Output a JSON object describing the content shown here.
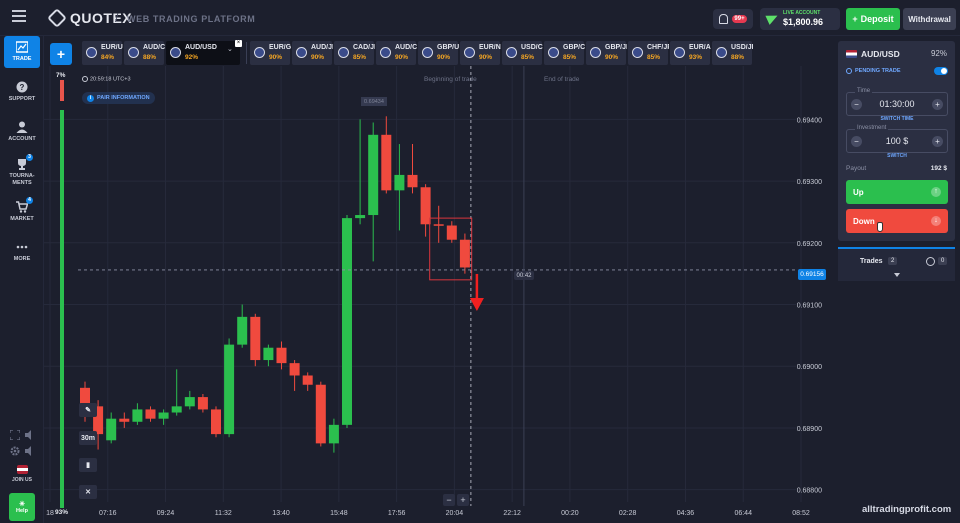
{
  "header": {
    "logo_text": "QUOTEX",
    "subtitle": "WEB TRADING PLATFORM",
    "notifications_badge": "99+",
    "account_type": "LIVE ACCOUNT",
    "balance": "$1,800.96",
    "deposit_label": "Deposit",
    "withdrawal_label": "Withdrawal"
  },
  "sidebar": {
    "items": [
      {
        "label": "TRADE",
        "icon": "chart-icon",
        "active": true
      },
      {
        "label": "SUPPORT",
        "icon": "question-icon"
      },
      {
        "label": "ACCOUNT",
        "icon": "user-icon"
      },
      {
        "label": "TOURNA-\nMENTS",
        "icon": "trophy-icon",
        "badge": "3"
      },
      {
        "label": "MARKET",
        "icon": "cart-icon",
        "badge": "4"
      },
      {
        "label": "MORE",
        "icon": "dots-icon"
      }
    ],
    "join_us": "JOIN US",
    "help": "Help"
  },
  "assets": {
    "tabs": [
      {
        "name": "EUR/USD",
        "pct": "84%"
      },
      {
        "name": "AUD/CAD",
        "pct": "88%"
      },
      {
        "name": "AUD/USD",
        "pct": "92%",
        "selected": true
      },
      {
        "name": "EUR/GBP",
        "pct": "90%"
      },
      {
        "name": "AUD/JPY",
        "pct": "90%"
      },
      {
        "name": "CAD/JPY",
        "pct": "85%"
      },
      {
        "name": "AUD/CHF",
        "pct": "90%"
      },
      {
        "name": "GBP/USD",
        "pct": "90%"
      },
      {
        "name": "EUR/NZD",
        "pct": "90%"
      },
      {
        "name": "USD/CAD",
        "pct": "85%"
      },
      {
        "name": "GBP/CAD",
        "pct": "85%"
      },
      {
        "name": "GBP/JPY",
        "pct": "90%"
      },
      {
        "name": "CHF/JPY",
        "pct": "85%"
      },
      {
        "name": "EUR/AUD",
        "pct": "93%"
      },
      {
        "name": "USD/JPY",
        "pct": "88%"
      }
    ]
  },
  "chart_area": {
    "sentiment_top": "7%",
    "sentiment_bottom": "93%",
    "sentiment_up_fraction": 0.93,
    "clock": "20:59:18",
    "utc": "UTC+3",
    "pair_info": "PAIR INFORMATION",
    "beginning_label": "Beginning of trade",
    "end_label": "End of trade",
    "current_price": "0.69156",
    "hover_price": "0.69434",
    "countdown": "00:42",
    "timeframe": "30m",
    "watermark": "alltradingprofit.com"
  },
  "chart_data": {
    "type": "candlestick",
    "y_ticks": [
      "0.69400",
      "0.69300",
      "0.69200",
      "0.69100",
      "0.69000",
      "0.68900",
      "0.68800"
    ],
    "x_ticks": [
      "18",
      "07:16",
      "09:24",
      "11:32",
      "13:40",
      "15:48",
      "17:56",
      "20:04",
      "22:12",
      "00:20",
      "02:28",
      "04:36",
      "06:44",
      "08:52"
    ],
    "ylim": [
      0.6878,
      0.6948
    ],
    "current_price": 0.69156,
    "candles": [
      {
        "o": 0.68965,
        "c": 0.68935,
        "h": 0.68975,
        "l": 0.6891
      },
      {
        "o": 0.68935,
        "c": 0.6889,
        "h": 0.68945,
        "l": 0.68865
      },
      {
        "o": 0.6888,
        "c": 0.68915,
        "h": 0.68925,
        "l": 0.68875
      },
      {
        "o": 0.68915,
        "c": 0.6891,
        "h": 0.68925,
        "l": 0.689
      },
      {
        "o": 0.6891,
        "c": 0.6893,
        "h": 0.6894,
        "l": 0.68905
      },
      {
        "o": 0.6893,
        "c": 0.68915,
        "h": 0.68935,
        "l": 0.6891
      },
      {
        "o": 0.68915,
        "c": 0.68925,
        "h": 0.6893,
        "l": 0.68905
      },
      {
        "o": 0.68925,
        "c": 0.68935,
        "h": 0.68995,
        "l": 0.6892
      },
      {
        "o": 0.68935,
        "c": 0.6895,
        "h": 0.6896,
        "l": 0.6893
      },
      {
        "o": 0.6895,
        "c": 0.6893,
        "h": 0.68955,
        "l": 0.68925
      },
      {
        "o": 0.6893,
        "c": 0.6889,
        "h": 0.68935,
        "l": 0.68885
      },
      {
        "o": 0.6889,
        "c": 0.69035,
        "h": 0.69045,
        "l": 0.68885
      },
      {
        "o": 0.69035,
        "c": 0.6908,
        "h": 0.691,
        "l": 0.6903
      },
      {
        "o": 0.6908,
        "c": 0.6901,
        "h": 0.69085,
        "l": 0.69
      },
      {
        "o": 0.6901,
        "c": 0.6903,
        "h": 0.69035,
        "l": 0.69
      },
      {
        "o": 0.6903,
        "c": 0.69005,
        "h": 0.6904,
        "l": 0.68995
      },
      {
        "o": 0.69005,
        "c": 0.68985,
        "h": 0.6901,
        "l": 0.6896
      },
      {
        "o": 0.68985,
        "c": 0.6897,
        "h": 0.6899,
        "l": 0.6896
      },
      {
        "o": 0.6897,
        "c": 0.68875,
        "h": 0.68975,
        "l": 0.6887
      },
      {
        "o": 0.68875,
        "c": 0.68905,
        "h": 0.68915,
        "l": 0.6886
      },
      {
        "o": 0.68905,
        "c": 0.6924,
        "h": 0.69245,
        "l": 0.689
      },
      {
        "o": 0.6924,
        "c": 0.69245,
        "h": 0.694,
        "l": 0.6923
      },
      {
        "o": 0.69245,
        "c": 0.69375,
        "h": 0.69395,
        "l": 0.6917
      },
      {
        "o": 0.69375,
        "c": 0.69285,
        "h": 0.69405,
        "l": 0.6928
      },
      {
        "o": 0.69285,
        "c": 0.6931,
        "h": 0.6936,
        "l": 0.6922
      },
      {
        "o": 0.6931,
        "c": 0.6929,
        "h": 0.6936,
        "l": 0.6928
      },
      {
        "o": 0.6929,
        "c": 0.6923,
        "h": 0.69295,
        "l": 0.6921
      },
      {
        "o": 0.6923,
        "c": 0.69228,
        "h": 0.6926,
        "l": 0.692
      },
      {
        "o": 0.69228,
        "c": 0.69205,
        "h": 0.69235,
        "l": 0.692
      },
      {
        "o": 0.69205,
        "c": 0.6916,
        "h": 0.69215,
        "l": 0.6915
      }
    ],
    "title": "AUD/USD"
  },
  "panel": {
    "pair": "AUD/USD",
    "pct": "92%",
    "pending_trade": "PENDING TRADE",
    "time_label": "Time",
    "time_value": "01:30:00",
    "switch_time": "SWITCH TIME",
    "investment_label": "Investment",
    "investment_value": "100 $",
    "switch": "SWITCH",
    "payout_label": "Payout",
    "payout_value": "192 $",
    "up_label": "Up",
    "down_label": "Down",
    "trades_label": "Trades",
    "trades_count": "2",
    "pending_count": "0"
  },
  "colors": {
    "accent": "#0f83e6",
    "up": "#2bbf4e",
    "down": "#f04a3e",
    "bg": "#1c1f2d"
  }
}
